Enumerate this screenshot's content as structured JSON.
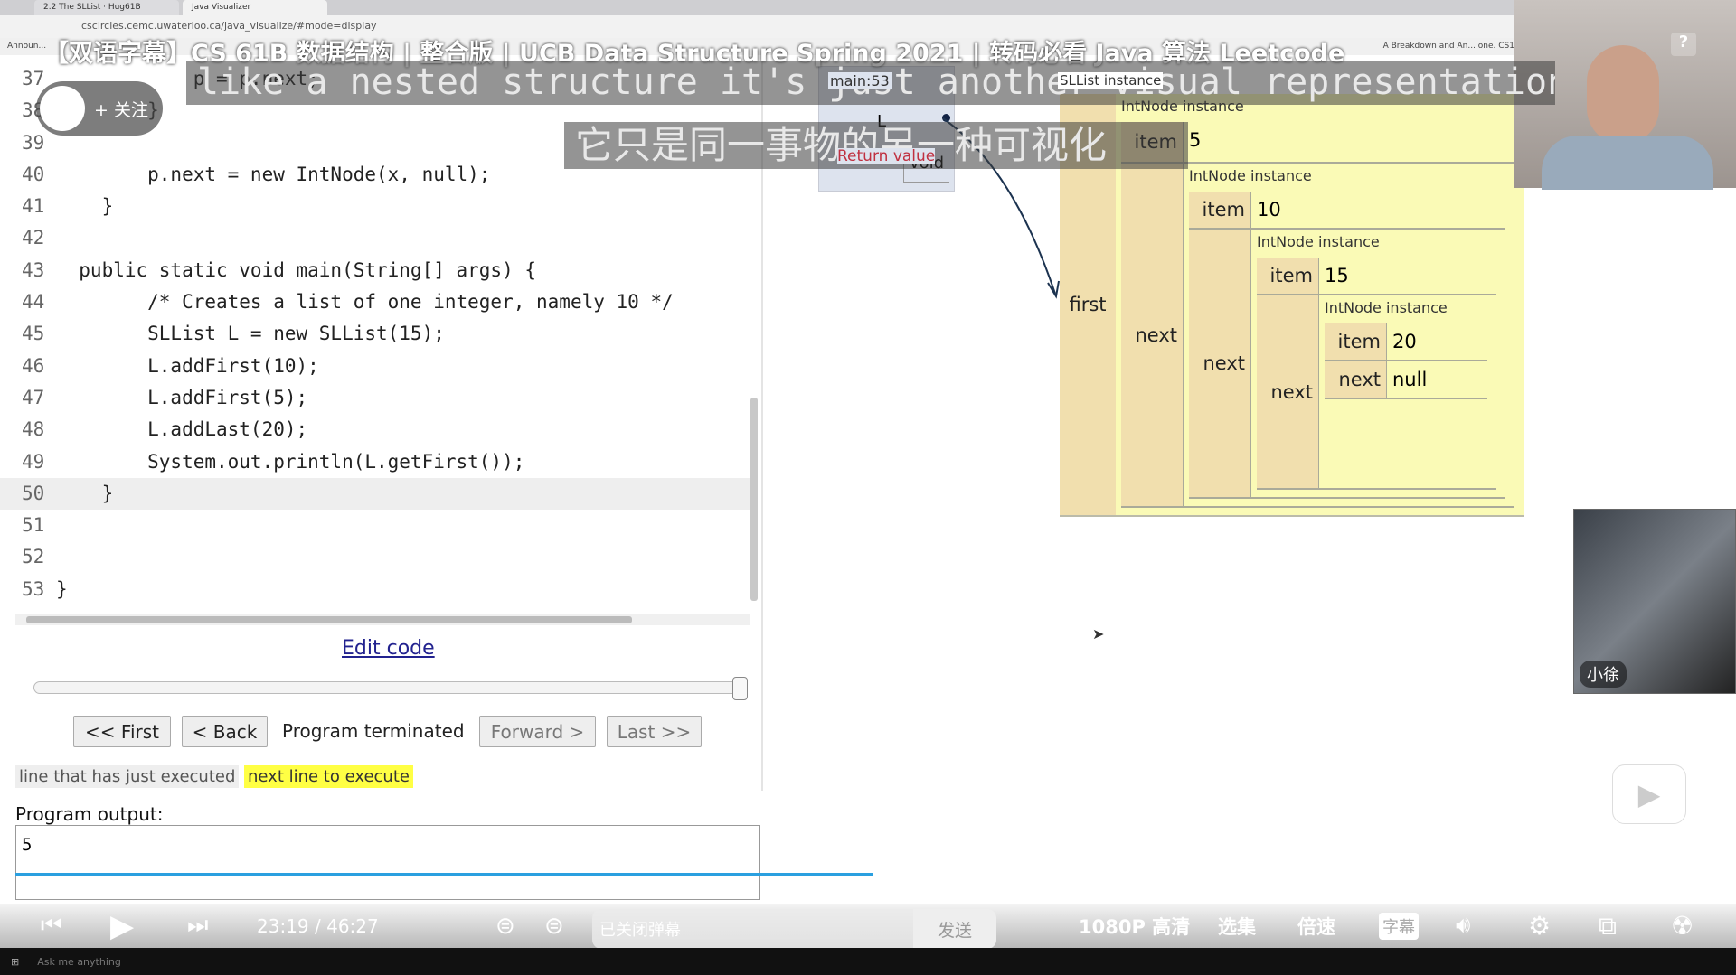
{
  "browser": {
    "tabs": [
      "2.2 The SLList · Hug61B",
      "Java Visualizer"
    ],
    "url": "cscircles.cemc.uwaterloo.ca/java_visualize/#mode=display",
    "bookmarks_left": "Announ...",
    "bookmarks_right": "A Breakdown and An...   one.   CS1"
  },
  "video": {
    "title": "【双语字幕】CS 61B 数据结构 | 整合版 | UCB Data Structure Spring 2021 | 转码必看 Java 算法 Leetcode",
    "subtitle_en": "like a nested structure it's just another visual representation",
    "subtitle_zh": "它只是同一事物的另一种可视化",
    "follow": "+ 关注",
    "help": "?",
    "mini_name": "小徐"
  },
  "code": {
    "lines": [
      {
        "n": "37",
        "t": "            p = p.next;"
      },
      {
        "n": "38",
        "t": "        }"
      },
      {
        "n": "39",
        "t": ""
      },
      {
        "n": "40",
        "t": "        p.next = new IntNode(x, null);"
      },
      {
        "n": "41",
        "t": "    }"
      },
      {
        "n": "42",
        "t": ""
      },
      {
        "n": "43",
        "t": "  public static void main(String[] args) {"
      },
      {
        "n": "44",
        "t": "        /* Creates a list of one integer, namely 10 */"
      },
      {
        "n": "45",
        "t": "        SLList L = new SLList(15);"
      },
      {
        "n": "46",
        "t": "        L.addFirst(10);"
      },
      {
        "n": "47",
        "t": "        L.addFirst(5);"
      },
      {
        "n": "48",
        "t": "        L.addLast(20);"
      },
      {
        "n": "49",
        "t": "        System.out.println(L.getFirst());"
      },
      {
        "n": "50",
        "t": "    }"
      },
      {
        "n": "51",
        "t": ""
      },
      {
        "n": "52",
        "t": ""
      },
      {
        "n": "53",
        "t": "}"
      }
    ],
    "highlight_line": "50"
  },
  "controls": {
    "edit": "Edit code",
    "first": "<< First",
    "back": "< Back",
    "status": "Program terminated",
    "forward": "Forward >",
    "last": "Last >>",
    "legend_executed": "line that has just executed",
    "legend_next": "next line to execute",
    "output_label": "Program output:",
    "output": "5",
    "step_progress": 1.0
  },
  "viz": {
    "frame_name": "main:53",
    "var": "L",
    "return_label": "Return value",
    "return_value": "void",
    "sllist_label": "SLList instance",
    "first": "first",
    "node_label": "IntNode instance",
    "item": "item",
    "next": "next",
    "items": [
      "5",
      "10",
      "15",
      "20"
    ],
    "last_next": "null"
  },
  "player": {
    "time": "23:19 / 46:27",
    "danmu_placeholder": "已关闭弹幕",
    "send": "发送",
    "quality": "1080P 高清",
    "episodes": "选集",
    "speed": "倍速",
    "subtitles": "字幕",
    "progress_percent": 50.1
  },
  "taskbar": {
    "search": "Ask me anything"
  }
}
